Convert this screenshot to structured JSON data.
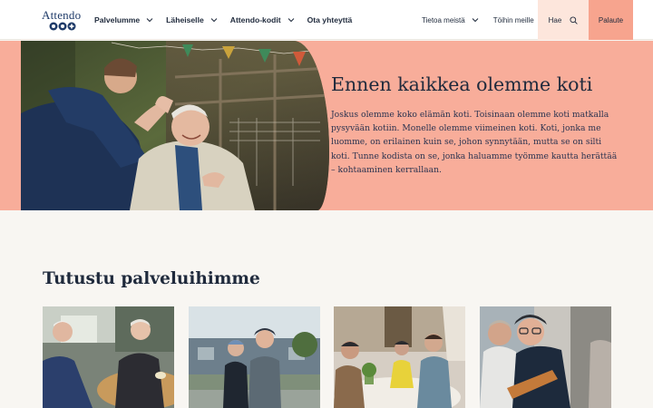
{
  "header": {
    "logo_text": "Attendo",
    "nav": [
      {
        "label": "Palvelumme",
        "has_dropdown": true
      },
      {
        "label": "Läheiselle",
        "has_dropdown": true
      },
      {
        "label": "Attendo-kodit",
        "has_dropdown": true
      },
      {
        "label": "Ota yhteyttä",
        "has_dropdown": false
      }
    ],
    "right_links": [
      {
        "label": "Tietoa meistä",
        "has_dropdown": true
      },
      {
        "label": "Töihin meille",
        "has_dropdown": false
      }
    ],
    "search_label": "Hae",
    "feedback_label": "Palaute"
  },
  "hero": {
    "title": "Ennen kaikkea olemme koti",
    "body": "Joskus olemme koko elämän koti. Toisinaan olemme koti matkalla pysyvään kotiin. Monelle olemme viimeinen koti. Koti, jonka me luomme, on erilainen kuin se, johon synnytään, mutta se on silti koti. Tunne kodista on se, jonka haluamme työmme kautta herättää – kohtaaminen kerrallaan."
  },
  "services": {
    "title": "Tutustu palveluihimme"
  },
  "colors": {
    "brand_navy": "#1e3a68",
    "hero_salmon": "#f8ad9a",
    "feedback_coral": "#f7a48e",
    "search_peach": "#fde6dc",
    "page_bg": "#f8f6f2"
  }
}
